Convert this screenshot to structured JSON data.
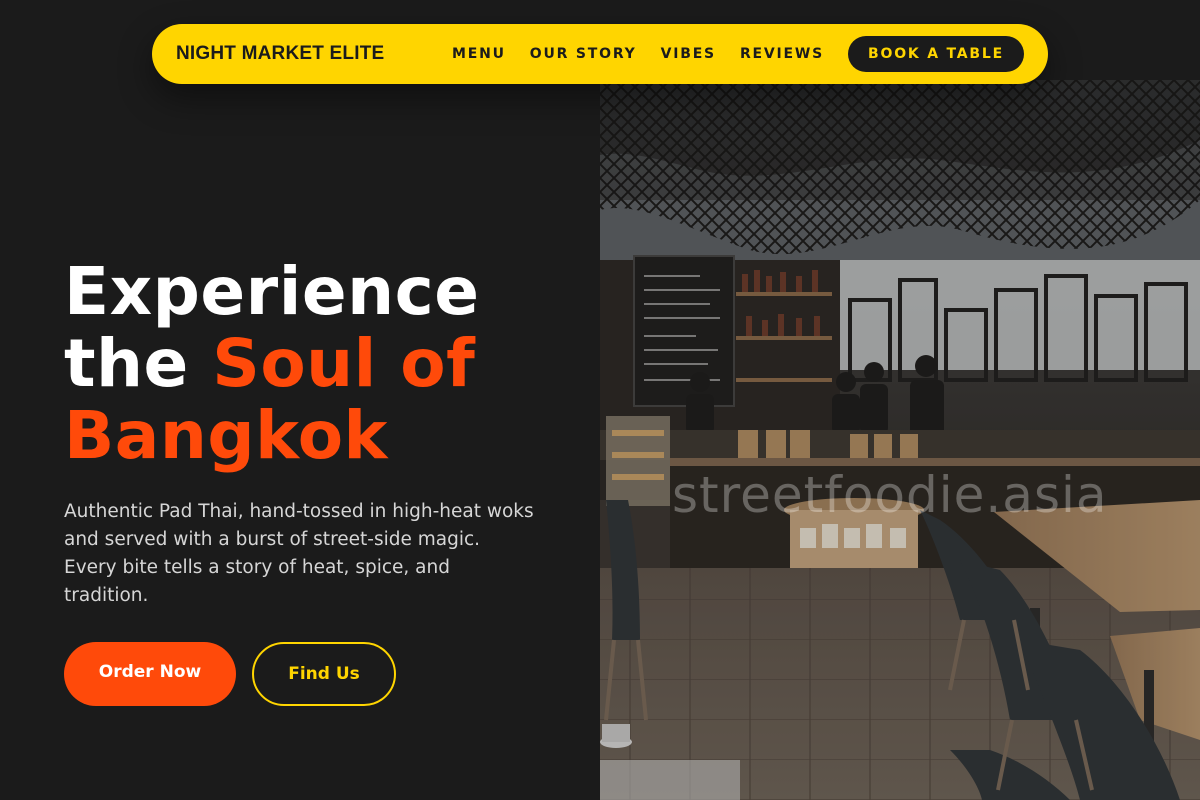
{
  "brand": {
    "name": "NIGHT MARKET ELITE"
  },
  "nav": {
    "links": [
      "MENU",
      "OUR STORY",
      "VIBES",
      "REVIEWS"
    ],
    "cta": "BOOK A TABLE"
  },
  "hero": {
    "headline_line1": "Experience",
    "headline_line2_plain": "the ",
    "headline_line2_accent": "Soul of",
    "headline_line3_accent": "Bangkok",
    "description": "Authentic Pad Thai, hand-tossed in high-heat woks and served with a burst of street-side magic. Every bite tells a story of heat, spice, and tradition.",
    "primary_button": "Order Now",
    "secondary_button": "Find Us"
  },
  "image": {
    "watermark": "streetfoodie.asia"
  },
  "colors": {
    "accent_yellow": "#ffd500",
    "accent_orange": "#ff4a0a",
    "background": "#1b1b1b",
    "text_light": "#d6d6d6"
  }
}
